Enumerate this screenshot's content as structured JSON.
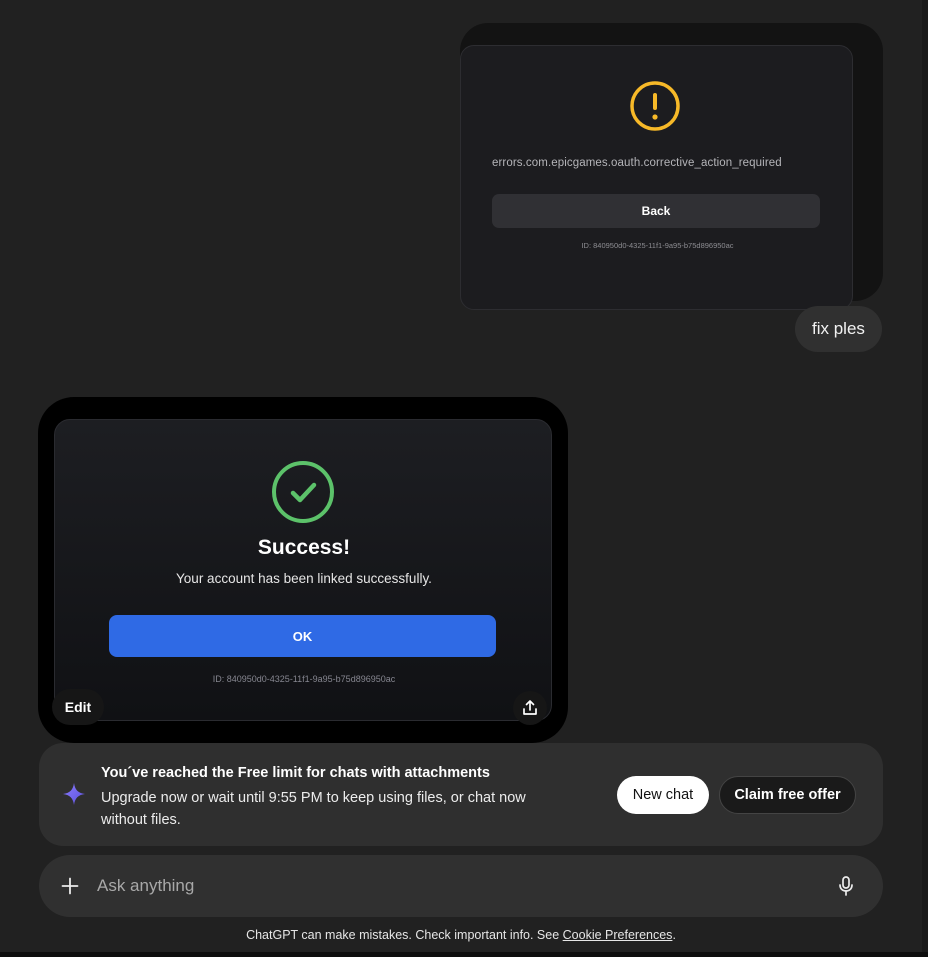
{
  "user_image": {
    "error_text": "errors.com.epicgames.oauth.corrective_action_required",
    "back_label": "Back",
    "id_text": "ID: 840950d0-4325-11f1-9a95-b75d896950ac",
    "icon": "warning-circle-icon",
    "icon_color": "#f7b928"
  },
  "user_message": "fix ples",
  "generated_image": {
    "title": "Success!",
    "subtitle": "Your account has been linked successfully.",
    "ok_label": "OK",
    "id_text": "ID: 840950d0-4325-11f1-9a95-b75d896950ac",
    "icon": "check-circle-icon",
    "icon_color": "#5cc26a",
    "button_color": "#2f6ae5",
    "edit_label": "Edit",
    "share_icon": "share-icon"
  },
  "limit_banner": {
    "icon": "sparkle-icon",
    "title": "You´ve reached the Free limit for chats with attachments",
    "description": "Upgrade now or wait until 9:55 PM to keep using files, or chat now without files.",
    "new_chat_label": "New chat",
    "claim_label": "Claim free offer"
  },
  "composer": {
    "placeholder": "Ask anything",
    "plus_icon": "plus-icon",
    "mic_icon": "microphone-icon"
  },
  "footer": {
    "text": "ChatGPT can make mistakes. Check important info. See ",
    "link": "Cookie Preferences",
    "suffix": "."
  }
}
